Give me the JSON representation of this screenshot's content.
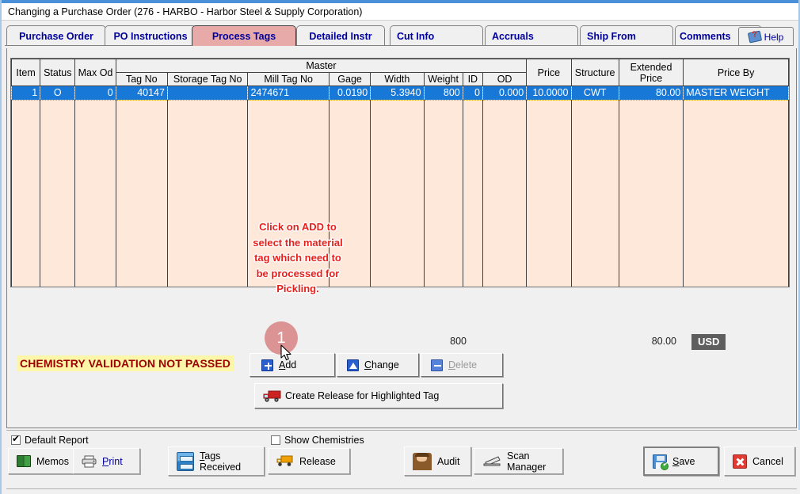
{
  "window": {
    "title": "Changing a Purchase Order  (276 - HARBO - Harbor Steel & Supply Corporation)"
  },
  "tabs": [
    {
      "label": "Purchase Order",
      "selected": false
    },
    {
      "label": "PO Instructions",
      "selected": false
    },
    {
      "label": "Process Tags",
      "selected": true
    },
    {
      "label": "Detailed Instr",
      "selected": false
    },
    {
      "label": "Cut Info",
      "selected": false
    },
    {
      "label": "Accruals",
      "selected": false
    },
    {
      "label": "Ship From",
      "selected": false
    },
    {
      "label": "Comments",
      "selected": false
    }
  ],
  "help_tab": {
    "label": "Help",
    "icon": "help-book-icon"
  },
  "grid": {
    "group_header": "Master",
    "columns": [
      "Item",
      "Status",
      "Max Od",
      "Tag No",
      "Storage Tag No",
      "Mill Tag No",
      "Gage",
      "Width",
      "Weight",
      "ID",
      "OD",
      "Price",
      "Structure",
      "Extended Price",
      "Price By"
    ],
    "rows": [
      {
        "item": "1",
        "status": "O",
        "max_od": "0",
        "tag_no": "40147",
        "storage_tag_no": "",
        "mill_tag_no": "2474671",
        "gage": "0.0190",
        "width": "5.3940",
        "weight": "800",
        "id": "0",
        "od": "0.000",
        "price": "10.0000",
        "structure": "CWT",
        "extended_price": "80.00",
        "price_by": "MASTER WEIGHT"
      }
    ]
  },
  "totals": {
    "weight": "800",
    "extended_price": "80.00",
    "currency": "USD"
  },
  "annotation": {
    "text": "Click on ADD to select the material tag which need to be processed for Pickling.",
    "badge": "1"
  },
  "warning": {
    "text": "CHEMISTRY VALIDATION NOT PASSED"
  },
  "actions": {
    "add": {
      "label": "Add",
      "accel": "A",
      "icon": "plus-icon",
      "disabled": false
    },
    "change": {
      "label": "Change",
      "accel": "C",
      "icon": "triangle-up-icon",
      "disabled": false
    },
    "delete": {
      "label": "Delete",
      "accel": "D",
      "icon": "minus-icon",
      "disabled": true
    },
    "create_release": {
      "label": "Create Release for Highlighted Tag",
      "icon": "red-truck-icon"
    }
  },
  "footer": {
    "default_report": {
      "label": "Default Report",
      "checked": true
    },
    "show_chemistries": {
      "label": "Show Chemistries",
      "checked": false
    },
    "memos": {
      "label": "Memos",
      "icon": "green-book-icon"
    },
    "print": {
      "label": "Print",
      "accel": "P",
      "icon": "printer-icon"
    },
    "tags_received": {
      "label": "Tags Received",
      "accel": "T",
      "icon": "blue-cabinet-icon"
    },
    "release": {
      "label": "Release",
      "icon": "orange-truck-icon"
    },
    "audit": {
      "label": "Audit",
      "icon": "detective-icon"
    },
    "scan_manager": {
      "label": "Scan Manager",
      "icon": "scanner-icon"
    },
    "save": {
      "label": "Save",
      "accel": "S",
      "icon": "floppy-save-icon"
    },
    "cancel": {
      "label": "Cancel",
      "icon": "red-x-icon"
    }
  },
  "colors": {
    "tab_selected": "#e8a9a9",
    "tab_text": "#00009c",
    "row_selected": "#1878d8",
    "grid_body": "#fde8da",
    "annotation": "#e8201a",
    "warning_bg": "#fbf6a8",
    "warning_text": "#9c0000",
    "currency_badge": "#5e5e5e"
  }
}
